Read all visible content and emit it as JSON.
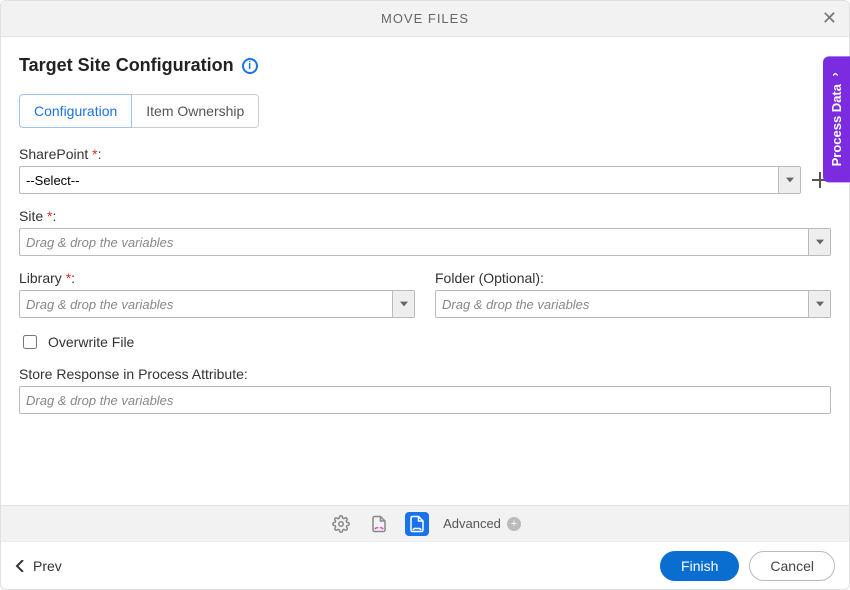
{
  "titlebar": {
    "title": "MOVE FILES"
  },
  "section": {
    "title": "Target Site Configuration"
  },
  "tabs": [
    {
      "label": "Configuration",
      "active": true
    },
    {
      "label": "Item Ownership",
      "active": false
    }
  ],
  "side_panel": {
    "label": "Process Data"
  },
  "fields": {
    "sharepoint": {
      "label": "SharePoint",
      "value": "--Select--"
    },
    "site": {
      "label": "Site",
      "placeholder": "Drag & drop the variables"
    },
    "library": {
      "label": "Library",
      "placeholder": "Drag & drop the variables"
    },
    "folder": {
      "label": "Folder (Optional):",
      "placeholder": "Drag & drop the variables"
    },
    "overwrite": {
      "label": "Overwrite File",
      "checked": false
    },
    "store_resp": {
      "label": "Store Response in Process Attribute:",
      "placeholder": "Drag & drop the variables"
    }
  },
  "toolbar": {
    "advanced_label": "Advanced"
  },
  "footer": {
    "prev_label": "Prev",
    "finish_label": "Finish",
    "cancel_label": "Cancel"
  }
}
